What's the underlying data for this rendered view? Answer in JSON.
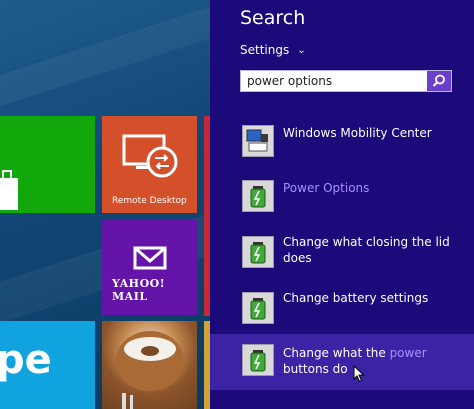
{
  "start_screen": {
    "tiles": {
      "remote_desktop_label": "Remote Desktop",
      "yahoo_mail_label": "YAHOO! MAIL",
      "skype_label": "pe"
    }
  },
  "search_panel": {
    "title": "Search",
    "scope_label": "Settings",
    "query": "power options",
    "results": [
      {
        "label": "Windows Mobility Center",
        "icon": "mobility-center-icon"
      },
      {
        "label": "Power Options",
        "icon": "power-options-icon",
        "highlighted": true
      },
      {
        "label": "Change what closing the lid does",
        "icon": "power-options-icon"
      },
      {
        "label": "Change battery settings",
        "icon": "power-options-icon"
      },
      {
        "label_pre": "Change what the ",
        "label_match": "power",
        "label_post": " buttons do",
        "icon": "power-options-icon",
        "hovered": true
      }
    ]
  },
  "colors": {
    "panel": "#1c0a7a",
    "accent": "#a890ff",
    "hover": "#3c23a6"
  }
}
